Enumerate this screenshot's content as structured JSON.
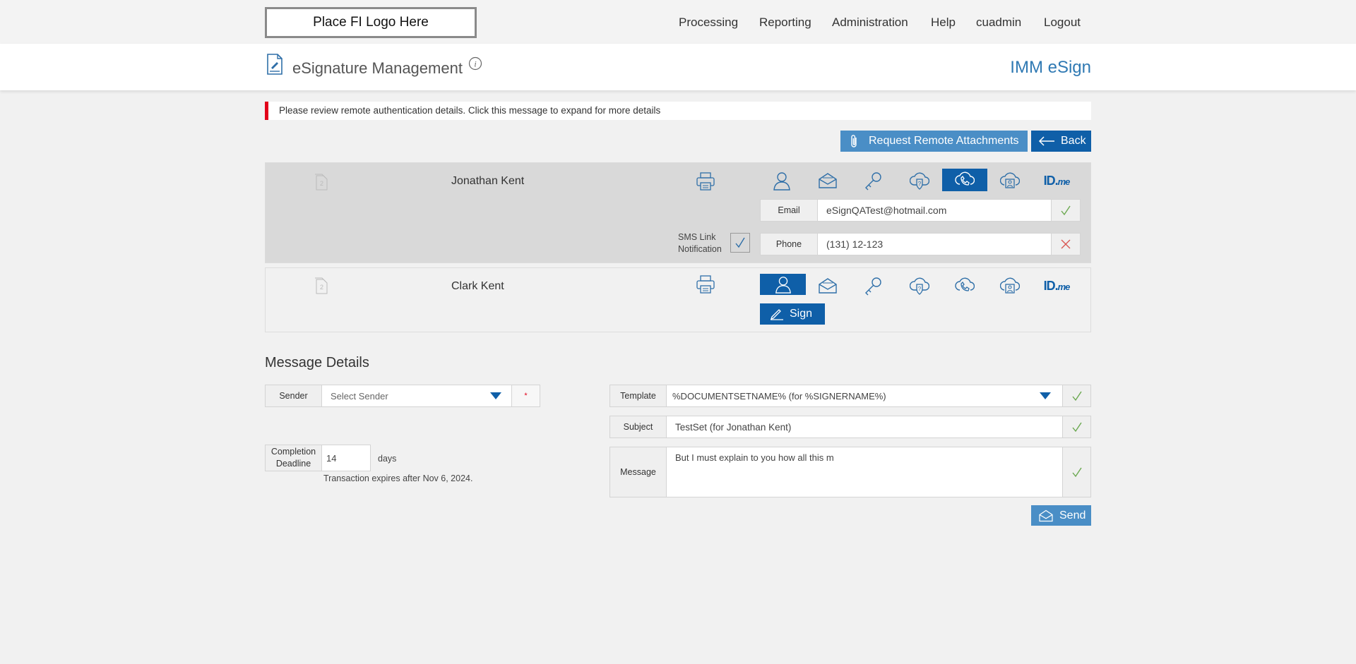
{
  "header": {
    "logo_text": "Place FI Logo Here",
    "nav": [
      "Processing",
      "Reporting",
      "Administration",
      "Help",
      "cuadmin",
      "Logout"
    ]
  },
  "titlebar": {
    "title": "eSignature Management",
    "brand": "IMM eSign"
  },
  "alert": {
    "message": "Please review remote authentication details. Click this message to expand for more details"
  },
  "actions": {
    "request_attachments": "Request Remote Attachments",
    "back": "Back"
  },
  "signers": [
    {
      "name": "Jonathan Kent",
      "active_auth": "phone",
      "sms_label_line1": "SMS Link",
      "sms_label_line2": "Notification",
      "email_label": "Email",
      "email_value": "eSignQATest@hotmail.com",
      "phone_label": "Phone",
      "phone_value": "(131) 12-123"
    },
    {
      "name": "Clark Kent",
      "active_auth": "in-person",
      "sign_label": "Sign"
    }
  ],
  "auth_methods": [
    "in-person",
    "email",
    "knowledge-key",
    "security-question",
    "phone",
    "id-verification",
    "idme"
  ],
  "idme": {
    "main": "ID.",
    "suffix": "me"
  },
  "message_details": {
    "title": "Message Details",
    "sender_label": "Sender",
    "sender_placeholder": "Select Sender",
    "required_marker": "*",
    "deadline_label_line1": "Completion",
    "deadline_label_line2": "Deadline",
    "deadline_value": "14",
    "deadline_unit": "days",
    "expires_text": "Transaction expires after Nov 6, 2024.",
    "template_label": "Template",
    "template_value": "%DOCUMENTSETNAME% (for %SIGNERNAME%)",
    "subject_label": "Subject",
    "subject_value": "TestSet (for Jonathan Kent)",
    "message_label": "Message",
    "message_value": "But I must explain to you how all this m",
    "send": "Send"
  },
  "colors": {
    "primary": "#0f5fa8",
    "primary_light": "#4a8ec6",
    "alert_bar": "#e2001a",
    "brand_text": "#2f79b3",
    "check_green": "#6aa84f",
    "cross_red": "#d9534f"
  }
}
